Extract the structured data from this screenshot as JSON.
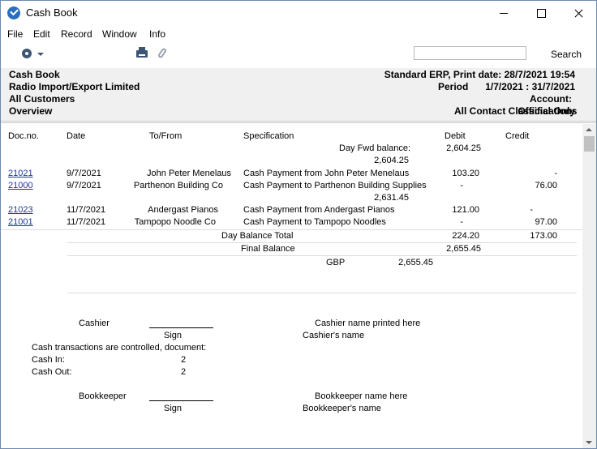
{
  "window": {
    "title": "Cash Book"
  },
  "menu": [
    "File",
    "Edit",
    "Record",
    "Window",
    "Info"
  ],
  "toolbar": {
    "search_value": "",
    "search_button": "Search"
  },
  "header": {
    "report_name": "Cash Book",
    "company": "Radio Import/Export Limited",
    "customers": "All Customers",
    "overview": "Overview",
    "print_info": "Standard ERP, Print date: 28/7/2021 19:54",
    "period_label": "Period",
    "period_value": "1/7/2021 : 31/7/2021",
    "account_label": "Account:",
    "contact_classes": "All Contact Classifications",
    "official_only": "Official Only"
  },
  "columns": {
    "docno": "Doc.no.",
    "date": "Date",
    "tofrom": "To/From",
    "spec": "Specification",
    "debit": "Debit",
    "credit": "Credit"
  },
  "day_fwd": {
    "label": "Day Fwd balance:",
    "debit": "2,604.25"
  },
  "balances": [
    "2,604.25",
    "2,631.45"
  ],
  "rows": [
    {
      "docno": "21021",
      "date": "9/7/2021",
      "tofrom": "John Peter Menelaus",
      "spec": "Cash Payment from John Peter Menelaus",
      "debit": "103.20",
      "credit": "-"
    },
    {
      "docno": "21000",
      "date": "9/7/2021",
      "tofrom": "Parthenon Building Co",
      "spec": "Cash Payment to Parthenon Building Supplies",
      "debit": "-",
      "credit": "76.00"
    },
    {
      "docno": "21023",
      "date": "11/7/2021",
      "tofrom": "Andergast Pianos",
      "spec": "Cash Payment from Andergast Pianos",
      "debit": "121.00",
      "credit": "-"
    },
    {
      "docno": "21001",
      "date": "11/7/2021",
      "tofrom": "Tampopo Noodle Co",
      "spec": "Cash Payment to Tampopo Noodles",
      "debit": "-",
      "credit": "97.00"
    }
  ],
  "day_total": {
    "label": "Day Balance Total",
    "debit": "224.20",
    "credit": "173.00"
  },
  "final_balance": {
    "label": "Final Balance",
    "value": "2,655.45"
  },
  "currency": {
    "code": "GBP",
    "value": "2,655.45"
  },
  "signature": {
    "cashier": "Cashier",
    "sign": "Sign",
    "cashier_name": "Cashier name printed here",
    "cashiers_name": "Cashier's name",
    "controlled": "Cash transactions are controlled, document:",
    "cash_in_label": "Cash In:",
    "cash_in_value": "2",
    "cash_out_label": "Cash Out:",
    "cash_out_value": "2",
    "bookkeeper": "Bookkeeper",
    "bookkeeper_name": "Bookkeeper name here",
    "bookkeepers_name": "Bookkeeper's name"
  }
}
